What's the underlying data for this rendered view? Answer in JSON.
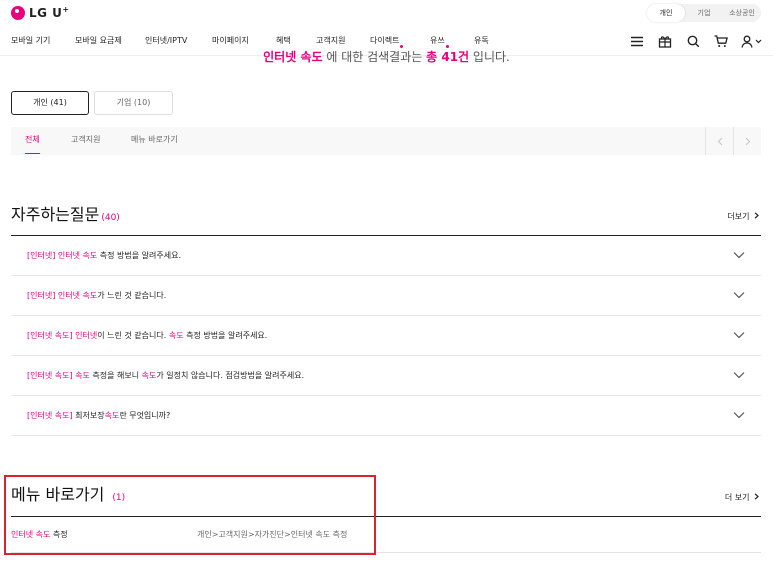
{
  "header": {
    "logo_text": "LG U",
    "logo_sup": "+",
    "segments": [
      "개인",
      "기업",
      "소상공인"
    ],
    "active_segment": 0
  },
  "nav": {
    "items": [
      {
        "label": "모바일 기기",
        "dot": false
      },
      {
        "label": "모바일 요금제",
        "dot": false
      },
      {
        "label": "인터넷/IPTV",
        "dot": false
      },
      {
        "label": "마이페이지",
        "dot": false
      },
      {
        "label": "혜택",
        "dot": false
      },
      {
        "label": "고객지원",
        "dot": false
      },
      {
        "label": "다이렉트",
        "dot": true
      },
      {
        "label": "유쓰",
        "dot": true
      },
      {
        "label": "유독",
        "dot": false
      }
    ],
    "icons": [
      "menu-icon",
      "gift-icon",
      "search-icon",
      "cart-icon",
      "user-icon"
    ]
  },
  "summary": {
    "keyword": "인터넷 속도",
    "middle": " 에 대한 검색결과는 ",
    "count": "총 41건",
    "end": " 입니다."
  },
  "big_tabs": [
    {
      "label": "개인 (41)",
      "active": true
    },
    {
      "label": "기업 (10)",
      "active": false
    }
  ],
  "sub_tabs": [
    {
      "label": "전체",
      "active": true
    },
    {
      "label": "고객지원",
      "active": false
    },
    {
      "label": "메뉴 바로가기",
      "active": false
    }
  ],
  "faq": {
    "title": "자주하는질문",
    "count": "(40)",
    "more_label": "더보기",
    "items": [
      [
        {
          "t": "[인터넷] 인터넷 속도",
          "hl": true
        },
        {
          "t": " 측정 방법을 알려주세요.",
          "hl": false
        }
      ],
      [
        {
          "t": "[인터넷] 인터넷 속도",
          "hl": true
        },
        {
          "t": "가 느린 것 같습니다.",
          "hl": false
        }
      ],
      [
        {
          "t": "[인터넷 속도] 인터넷",
          "hl": true
        },
        {
          "t": "이 느린 것 같습니다. ",
          "hl": false
        },
        {
          "t": "속도",
          "hl": true
        },
        {
          "t": " 측정 방법을 알려주세요.",
          "hl": false
        }
      ],
      [
        {
          "t": "[인터넷 속도] 속도",
          "hl": true
        },
        {
          "t": " 측정을 해보니 ",
          "hl": false
        },
        {
          "t": "속도",
          "hl": true
        },
        {
          "t": "가 일정치 않습니다. 점검방법을 알려주세요.",
          "hl": false
        }
      ],
      [
        {
          "t": "[인터넷 속도]",
          "hl": true
        },
        {
          "t": " 최저보장",
          "hl": false
        },
        {
          "t": "속도",
          "hl": true
        },
        {
          "t": "란 무엇입니까?",
          "hl": false
        }
      ]
    ]
  },
  "menu": {
    "title": "메뉴 바로가기",
    "count": "(1)",
    "more_label": "더 보기",
    "row_highlight": "인터넷 속도",
    "row_rest": " 측정",
    "row_path": "개인>고객지원>자가진단>인터넷 속도 측정"
  },
  "colors": {
    "accent": "#e6007e",
    "annotation_box": "#d9242b"
  }
}
